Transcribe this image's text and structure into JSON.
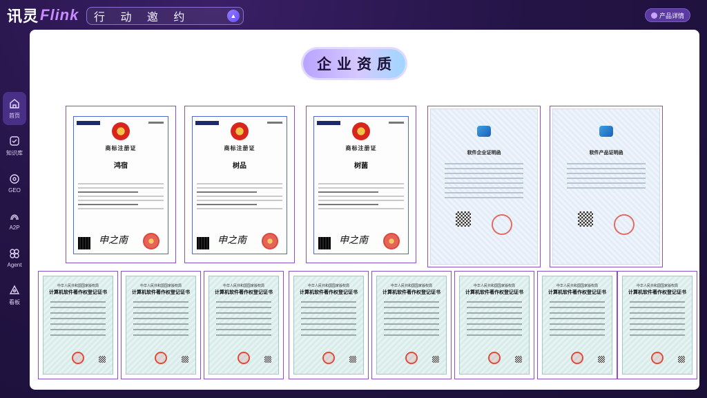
{
  "brand": {
    "part1": "讯灵",
    "part2": "Flink"
  },
  "search": {
    "text": "行 动 邀 约"
  },
  "header": {
    "product_details": "产品详情"
  },
  "sidebar": {
    "items": [
      {
        "label": "首页",
        "icon": "home-icon",
        "active": true
      },
      {
        "label": "知识库",
        "icon": "knowledge-icon",
        "active": false
      },
      {
        "label": "GEO",
        "icon": "geo-icon",
        "active": false
      },
      {
        "label": "A2P",
        "icon": "a2p-icon",
        "active": false
      },
      {
        "label": "Agent",
        "icon": "agent-icon",
        "active": false
      },
      {
        "label": "看板",
        "icon": "dashboard-icon",
        "active": false
      }
    ]
  },
  "main": {
    "title": "企业资质",
    "trademarks": [
      {
        "heading": "商标注册证",
        "mark": "鸿宿"
      },
      {
        "heading": "商标注册证",
        "mark": "树品"
      },
      {
        "heading": "商标注册证",
        "mark": "树菌"
      }
    ],
    "software_certs": [
      {
        "heading": "软件企业证明函"
      },
      {
        "heading": "软件产品证明函"
      }
    ],
    "copyright_certs": [
      {
        "h1": "中华人民共和国国家版权局",
        "h2": "计算机软件著作权登记证书"
      },
      {
        "h1": "中华人民共和国国家版权局",
        "h2": "计算机软件著作权登记证书"
      },
      {
        "h1": "中华人民共和国国家版权局",
        "h2": "计算机软件著作权登记证书"
      },
      {
        "h1": "中华人民共和国国家版权局",
        "h2": "计算机软件著作权登记证书"
      },
      {
        "h1": "中华人民共和国国家版权局",
        "h2": "计算机软件著作权登记证书"
      },
      {
        "h1": "中华人民共和国国家版权局",
        "h2": "计算机软件著作权登记证书"
      },
      {
        "h1": "中华人民共和国国家版权局",
        "h2": "计算机软件著作权登记证书"
      },
      {
        "h1": "中华人民共和国国家版权局",
        "h2": "计算机软件著作权登记证书"
      }
    ]
  },
  "colors": {
    "accent": "#8a4fc6",
    "panel": "#ffffff",
    "background": "#241446"
  }
}
